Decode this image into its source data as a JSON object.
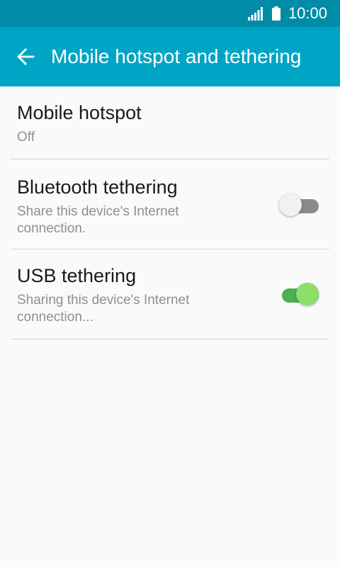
{
  "status_bar": {
    "time": "10:00",
    "icons": [
      "signal-icon",
      "battery-icon"
    ]
  },
  "app_bar": {
    "title": "Mobile hotspot and tethering",
    "back_icon": "arrow-back-icon"
  },
  "settings": {
    "mobile_hotspot": {
      "title": "Mobile hotspot",
      "summary": "Off"
    },
    "bluetooth_tethering": {
      "title": "Bluetooth tethering",
      "summary": "Share this device's Internet connection.",
      "enabled": false
    },
    "usb_tethering": {
      "title": "USB tethering",
      "summary": "Sharing this device's Internet connection...",
      "enabled": true
    }
  },
  "colors": {
    "status_bar": "#008ca6",
    "app_bar": "#00a5c5",
    "switch_on_track": "#4caf50",
    "switch_on_thumb": "#8bdf6a",
    "switch_off_track": "#8a8a8a",
    "switch_off_thumb": "#f1f1f1"
  }
}
